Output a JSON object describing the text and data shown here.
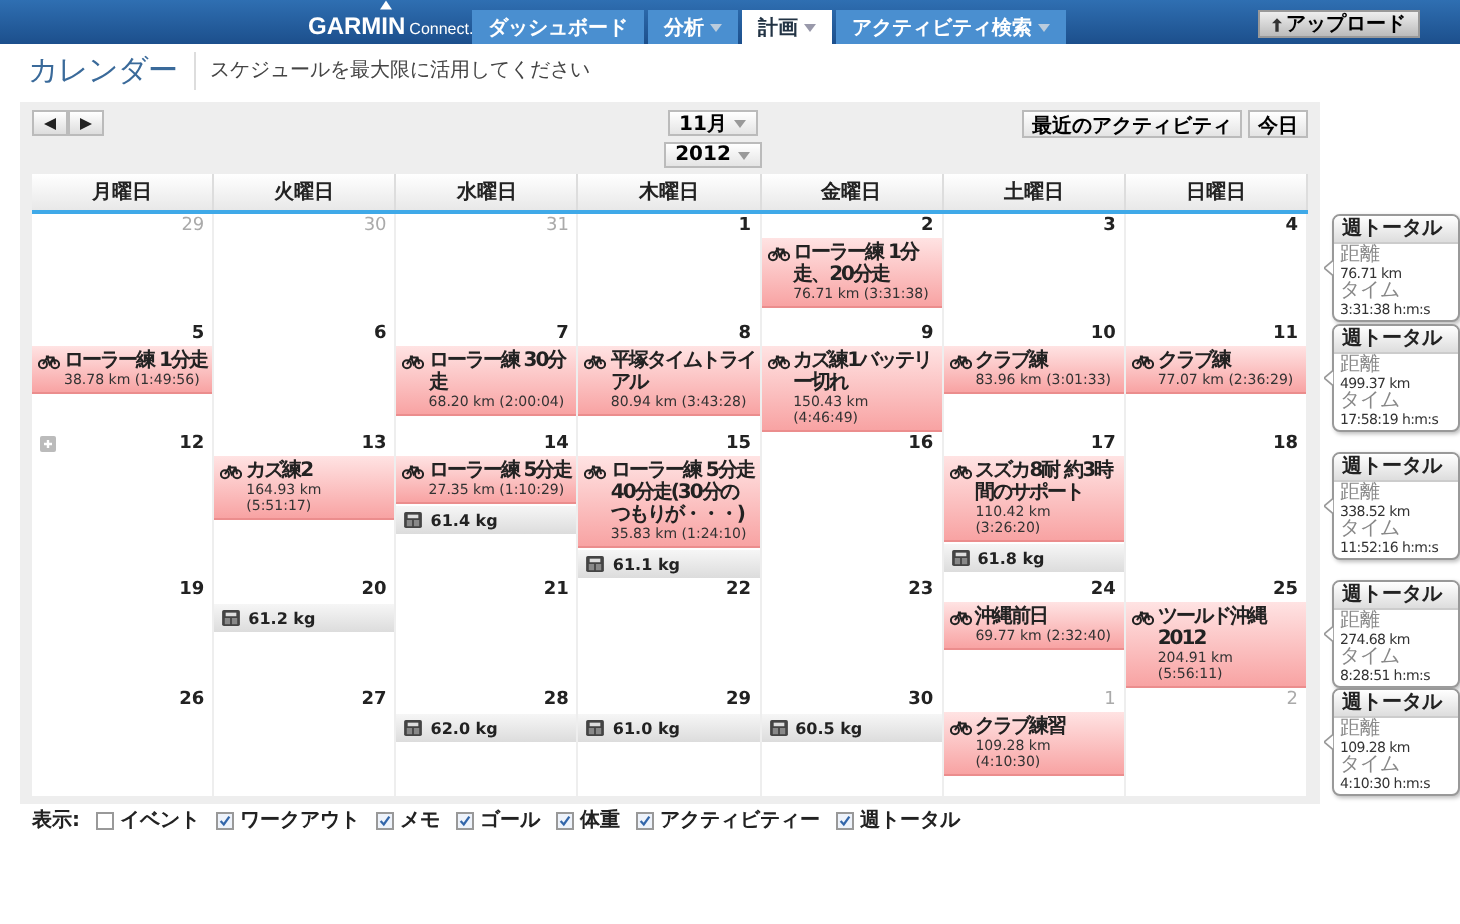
{
  "header": {
    "logo": {
      "brand": "GARMIN",
      "product": "Connect."
    },
    "nav": [
      {
        "label": "ダッシュボード",
        "dropdown": false,
        "selected": false
      },
      {
        "label": "分析",
        "dropdown": true,
        "selected": false
      },
      {
        "label": "計画",
        "dropdown": true,
        "selected": true
      },
      {
        "label": "アクティビティ検索",
        "dropdown": true,
        "selected": false
      }
    ],
    "upload_button": "アップロード"
  },
  "page": {
    "title": "カレンダー",
    "subtitle": "スケジュールを最大限に活用してください"
  },
  "toolbar": {
    "month": "11月",
    "year": "2012",
    "recent_button": "最近のアクティビティ",
    "today_button": "今日"
  },
  "weekdays": [
    "月曜日",
    "火曜日",
    "水曜日",
    "木曜日",
    "金曜日",
    "土曜日",
    "日曜日"
  ],
  "weeks": [
    {
      "days": [
        {
          "date": "29",
          "other_month": true
        },
        {
          "date": "30",
          "other_month": true
        },
        {
          "date": "31",
          "other_month": true
        },
        {
          "date": "1",
          "other_month": false
        },
        {
          "date": "2",
          "other_month": false,
          "entries": [
            {
              "kind": "activity",
              "title": "ローラー練 1分走、20分走",
              "detail": "76.71 km (3:31:38)"
            }
          ]
        },
        {
          "date": "3",
          "other_month": false
        },
        {
          "date": "4",
          "other_month": false
        }
      ],
      "total": {
        "title": "週トータル",
        "distance_label": "距離",
        "distance": "76.71 km",
        "time_label": "タイム",
        "time": "3:31:38 h:m:s"
      }
    },
    {
      "days": [
        {
          "date": "5",
          "other_month": false,
          "entries": [
            {
              "kind": "activity",
              "title": "ローラー練 1分走",
              "detail": "38.78 km (1:49:56)"
            }
          ]
        },
        {
          "date": "6",
          "other_month": false
        },
        {
          "date": "7",
          "other_month": false,
          "entries": [
            {
              "kind": "activity",
              "title": "ローラー練 30分走",
              "detail": "68.20 km (2:00:04)"
            }
          ]
        },
        {
          "date": "8",
          "other_month": false,
          "entries": [
            {
              "kind": "activity",
              "title": "平塚タイムトライアル",
              "detail": "80.94 km (3:43:28)"
            }
          ]
        },
        {
          "date": "9",
          "other_month": false,
          "entries": [
            {
              "kind": "activity",
              "title": "カズ練1バッテリー切れ",
              "detail": "150.43 km (4:46:49)"
            }
          ]
        },
        {
          "date": "10",
          "other_month": false,
          "entries": [
            {
              "kind": "activity",
              "title": "クラブ練",
              "detail": "83.96 km (3:01:33)"
            }
          ]
        },
        {
          "date": "11",
          "other_month": false,
          "entries": [
            {
              "kind": "activity",
              "title": "クラブ練",
              "detail": "77.07 km (2:36:29)"
            }
          ]
        }
      ],
      "total": {
        "title": "週トータル",
        "distance_label": "距離",
        "distance": "499.37 km",
        "time_label": "タイム",
        "time": "17:58:19 h:m:s"
      }
    },
    {
      "days": [
        {
          "date": "12",
          "other_month": false,
          "add_icon": true
        },
        {
          "date": "13",
          "other_month": false,
          "entries": [
            {
              "kind": "activity",
              "title": "カズ練2",
              "detail": "164.93 km (5:51:17)"
            }
          ]
        },
        {
          "date": "14",
          "other_month": false,
          "entries": [
            {
              "kind": "activity",
              "title": "ローラー練 5分走",
              "detail": "27.35 km (1:10:29)"
            },
            {
              "kind": "weight",
              "value": "61.4 kg"
            }
          ]
        },
        {
          "date": "15",
          "other_month": false,
          "entries": [
            {
              "kind": "activity",
              "title": "ローラー練 5分走 40分走(30分のつもりが・・・)",
              "detail": "35.83 km (1:24:10)"
            },
            {
              "kind": "weight",
              "value": "61.1 kg"
            }
          ]
        },
        {
          "date": "16",
          "other_month": false
        },
        {
          "date": "17",
          "other_month": false,
          "entries": [
            {
              "kind": "activity",
              "title": "スズカ8耐 約3時間のサポート",
              "detail": "110.42 km (3:26:20)"
            },
            {
              "kind": "weight",
              "value": "61.8 kg"
            }
          ]
        },
        {
          "date": "18",
          "other_month": false
        }
      ],
      "total": {
        "title": "週トータル",
        "distance_label": "距離",
        "distance": "338.52 km",
        "time_label": "タイム",
        "time": "11:52:16 h:m:s"
      }
    },
    {
      "days": [
        {
          "date": "19",
          "other_month": false
        },
        {
          "date": "20",
          "other_month": false,
          "entries": [
            {
              "kind": "weight",
              "value": "61.2 kg"
            }
          ]
        },
        {
          "date": "21",
          "other_month": false
        },
        {
          "date": "22",
          "other_month": false
        },
        {
          "date": "23",
          "other_month": false
        },
        {
          "date": "24",
          "other_month": false,
          "entries": [
            {
              "kind": "activity",
              "title": "沖縄前日",
              "detail": "69.77 km (2:32:40)"
            }
          ]
        },
        {
          "date": "25",
          "other_month": false,
          "entries": [
            {
              "kind": "activity",
              "title": "ツールド沖縄2012",
              "detail": "204.91 km (5:56:11)"
            }
          ]
        }
      ],
      "total": {
        "title": "週トータル",
        "distance_label": "距離",
        "distance": "274.68 km",
        "time_label": "タイム",
        "time": "8:28:51 h:m:s"
      }
    },
    {
      "days": [
        {
          "date": "26",
          "other_month": false
        },
        {
          "date": "27",
          "other_month": false
        },
        {
          "date": "28",
          "other_month": false,
          "entries": [
            {
              "kind": "weight",
              "value": "62.0 kg"
            }
          ]
        },
        {
          "date": "29",
          "other_month": false,
          "entries": [
            {
              "kind": "weight",
              "value": "61.0 kg"
            }
          ]
        },
        {
          "date": "30",
          "other_month": false,
          "entries": [
            {
              "kind": "weight",
              "value": "60.5 kg"
            }
          ]
        },
        {
          "date": "1",
          "other_month": true,
          "entries": [
            {
              "kind": "activity",
              "title": "クラブ練習",
              "detail": "109.28 km (4:10:30)"
            }
          ]
        },
        {
          "date": "2",
          "other_month": true
        }
      ],
      "total": {
        "title": "週トータル",
        "distance_label": "距離",
        "distance": "109.28 km",
        "time_label": "タイム",
        "time": "4:10:30 h:m:s"
      }
    }
  ],
  "legend": {
    "label": "表示:",
    "items": [
      {
        "label": "イベント",
        "checked": false
      },
      {
        "label": "ワークアウト",
        "checked": true
      },
      {
        "label": "メモ",
        "checked": true
      },
      {
        "label": "ゴール",
        "checked": true
      },
      {
        "label": "体重",
        "checked": true
      },
      {
        "label": "アクティビティー",
        "checked": true
      },
      {
        "label": "週トータル",
        "checked": true
      }
    ]
  }
}
